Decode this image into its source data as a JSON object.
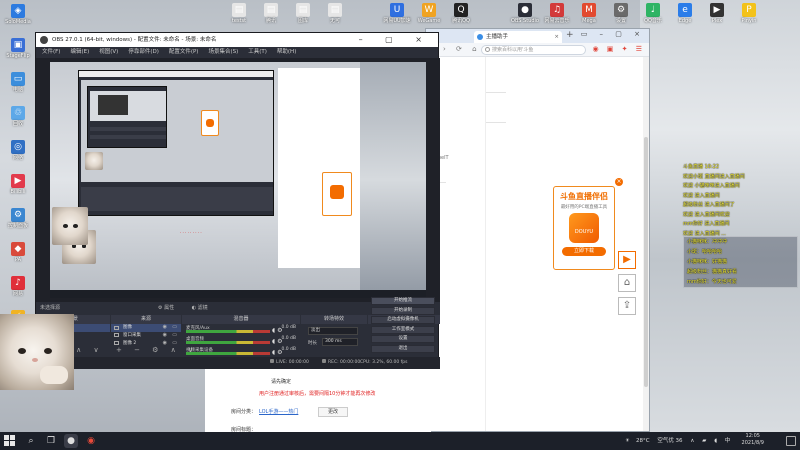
{
  "desktop": {
    "left_icons": [
      {
        "label": "SoloMedia",
        "color": "#2d7be0",
        "glyph": "◈"
      },
      {
        "label": "StageFlip",
        "color": "#3a6fd6",
        "glyph": "▣"
      },
      {
        "label": "电脑",
        "color": "#3c8edc",
        "glyph": "▭"
      },
      {
        "label": "回收",
        "color": "#5da8e8",
        "glyph": "♲"
      },
      {
        "label": "网络",
        "color": "#3170c4",
        "glyph": "◎"
      },
      {
        "label": "Bilibili",
        "color": "#e23a4c",
        "glyph": "▶"
      },
      {
        "label": "控制面板",
        "color": "#3a86d0",
        "glyph": "⚙"
      },
      {
        "label": "PA",
        "color": "#d94a3b",
        "glyph": "◆"
      },
      {
        "label": "网易",
        "color": "#e02f3a",
        "glyph": "♪"
      },
      {
        "label": "迅雷",
        "color": "#f0b324",
        "glyph": "⚡"
      },
      {
        "label": "Windows",
        "color": "#4b8ad8",
        "glyph": "◍"
      }
    ],
    "top_icons": [
      {
        "label": "testst",
        "color": "#e6e6e6",
        "glyph": "▤"
      },
      {
        "label": "腾讯",
        "color": "#e6e6e6",
        "glyph": "▤"
      },
      {
        "label": "图库",
        "color": "#e6e6e6",
        "glyph": "▤"
      },
      {
        "label": "无可",
        "color": "#e6e6e6",
        "glyph": "▤"
      },
      {
        "label": "网易UU加速",
        "color": "#2f6fe0",
        "glyph": "U"
      },
      {
        "label": "WeGame",
        "color": "#f0a321",
        "glyph": "W"
      },
      {
        "label": "腾讯QQ",
        "color": "#222222",
        "glyph": "Q"
      },
      {
        "label": "OBS Studio",
        "color": "#2b2e38",
        "glyph": "●"
      },
      {
        "label": "网易云音乐",
        "color": "#d33a3a",
        "glyph": "♫"
      },
      {
        "label": "Mega",
        "color": "#e24a30",
        "glyph": "M"
      },
      {
        "label": "设置",
        "color": "#6a6a6a",
        "glyph": "⚙"
      },
      {
        "label": "QQ音乐",
        "color": "#2fb464",
        "glyph": "♩"
      },
      {
        "label": "Edge",
        "color": "#2b7de9",
        "glyph": "e"
      },
      {
        "label": "Plex",
        "color": "#333333",
        "glyph": "▶"
      },
      {
        "label": "Pinyin",
        "color": "#f3c21a",
        "glyph": "P"
      }
    ]
  },
  "browser": {
    "tab_title": "主播助手",
    "search_placeholder": "搜索百科以用'斗鱼",
    "notice_text": "请先确定",
    "red_notice": "用户注册通过审核后，需要间隔10分钟才能再次修改",
    "category_label": "房间分类：",
    "category_link": "LOL手游——热门",
    "change_button": "更改",
    "room_title_label": "房间标题：",
    "right_label": "LabelT"
  },
  "promo": {
    "title": "斗鱼直播伴侣",
    "subtitle": "最好用的PC端直播工具",
    "logo_text": "DOUYU",
    "download": "立即下载"
  },
  "chat": {
    "lines": [
      "斗鱼直播 10:22",
      "欢迎小斑 直播间进入直播间",
      "欢迎 小猫咪咪进入直播间",
      "欢迎 进入直播间",
      "超级粉丝 进入直播间了",
      "欢迎 进入直播间欢迎",
      "mm你好 进入直播间",
      "欢迎 进入直播间 ..."
    ],
    "box_lines": [
      "小猫咪咪：冲冲冲",
      "小斑：哈哈哈哈",
      "小猫咪咪：好猫猫",
      "超级粉丝：猫猫真好看",
      "mm你好：今天也可爱"
    ]
  },
  "obs": {
    "title": "OBS 27.0.1 (64-bit, windows) - 配置文件: 未命名 - 场景: 未命名",
    "menu": [
      "文件(F)",
      "编辑(E)",
      "视图(V)",
      "停靠部件(D)",
      "配置文件(P)",
      "场景集合(S)",
      "工具(T)",
      "帮助(H)"
    ],
    "docks_label": "未选择源",
    "props_label": "属性",
    "filters_label": "滤镜",
    "scenes_header": "场景",
    "sources_header": "来源",
    "mixer_header": "混音器",
    "transitions_header": "转场特效",
    "controls_header": "控件",
    "scenes": [
      "场景"
    ],
    "sources": [
      "图像",
      "窗口采集",
      "图像 2",
      "窗口采集 3",
      "窗口采集",
      "显示器采集"
    ],
    "mixer": [
      {
        "name": "麦克风/Aux",
        "db": "0.0 dB"
      },
      {
        "name": "桌面音频",
        "db": "0.0 dB"
      },
      {
        "name": "视频采集设备",
        "db": "0.0 dB"
      }
    ],
    "transition_type": "淡出",
    "duration_label": "时长",
    "duration_value": "300 ms",
    "controls": [
      "开始推流",
      "开始录制",
      "启动虚拟摄像机",
      "工作室模式",
      "设置",
      "退出"
    ],
    "status": {
      "live": "LIVE: 00:00:00",
      "rec": "REC: 00:00:00",
      "cpu": "CPU: 3.2%, 60.00 fps"
    }
  },
  "taskbar": {
    "temperature": "28°C",
    "air": "空气优 36",
    "ime": "中",
    "time": "12:05",
    "date": "2021/8/9"
  },
  "colors": {
    "obs_bg": "#2b2e38",
    "accent_orange": "#f36c00",
    "chat_yellow": "#f7ef3a",
    "link_blue": "#2b66c9",
    "notice_red": "#e02020"
  }
}
